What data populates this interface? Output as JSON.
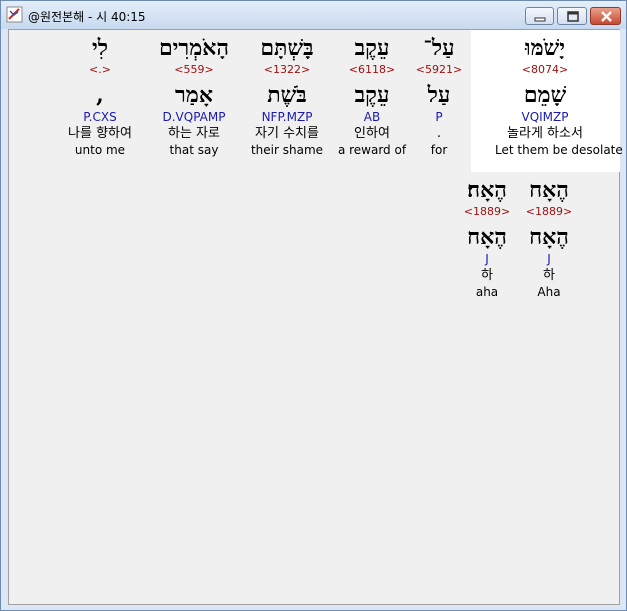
{
  "window": {
    "title": "@원전본해 - 시 40:15"
  },
  "words": [
    {
      "hebrew": "יָשֹׁמּוּ",
      "strong": "<8074>",
      "lemma": "שָׁמֵם",
      "morph": "VQIMZP",
      "korean": "놀라게 하소서",
      "english": "Let them be desolate",
      "highlighted": true
    },
    {
      "hebrew": "עַל־",
      "strong": "<5921>",
      "lemma": "עַל",
      "morph": "P",
      "korean": ".",
      "english": "for",
      "highlighted": false
    },
    {
      "hebrew": "עֵקֶב",
      "strong": "<6118>",
      "lemma": "עֵקֶב",
      "morph": "AB",
      "korean": "인하여",
      "english": "a reward of",
      "highlighted": false
    },
    {
      "hebrew": "בָּשְׁתָּם",
      "strong": "<1322>",
      "lemma": "בֹּשֶׁת",
      "morph": "NFP.MZP",
      "korean": "자기 수치를",
      "english": "their shame",
      "highlighted": false
    },
    {
      "hebrew": "הָאֹמְרִים",
      "strong": "<559>",
      "lemma": "אָמַר",
      "morph": "D.VQPAMP",
      "korean": "하는 자로",
      "english": "that say",
      "highlighted": false
    },
    {
      "hebrew": "לִי",
      "strong": "<.>",
      "lemma": ",",
      "morph": "P.CXS",
      "korean": "나를 향하여",
      "english": "unto me",
      "highlighted": false
    },
    {
      "hebrew": "הֶאָח",
      "strong": "<1889>",
      "lemma": "הֶאָח",
      "morph": "J",
      "korean": "하",
      "english": "Aha",
      "highlighted": false
    },
    {
      "hebrew": "הֶאָח׃",
      "strong": "<1889>",
      "lemma": "הֶאָח",
      "morph": "J",
      "korean": "하",
      "english": "aha",
      "highlighted": false
    }
  ]
}
